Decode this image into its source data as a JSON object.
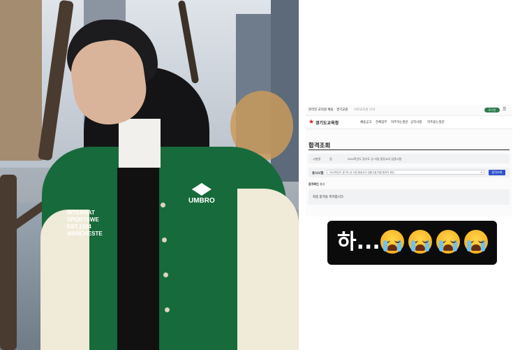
{
  "photo": {
    "jacket_logo": "UMBRO",
    "jacket_patch": [
      "INTERNAT",
      "SPORTSWE",
      "EST.1924",
      "MANCHESTE"
    ]
  },
  "story": {
    "site": {
      "top_links": [
        "온라인 교직원 채용",
        "경기교원",
        "바로교직원 안내"
      ],
      "login_label": "로그인",
      "org_name": "경기도교육청",
      "nav_items": [
        "채용공고",
        "전체업무",
        "자주하는질문",
        "공지사항",
        "자주묻는질문"
      ],
      "page_title": "합격조회",
      "info_labels": [
        "시험명",
        "일",
        "2024학년도 경기도 공·사립 중등교사 임용시험"
      ],
      "exam_label": "응시시험",
      "exam_select": "2024학년도 경기도 공·사립 중등교사 임용시험 최종 합격자 확인",
      "search_label": "합격조회",
      "result_label": "합격확인",
      "result_sub": "결과",
      "result_message": "최종 합격을 축하합니다."
    },
    "caption": {
      "text": "하...",
      "emoji_icon": "loudly-crying-face-icon",
      "emoji_count": 4
    }
  }
}
